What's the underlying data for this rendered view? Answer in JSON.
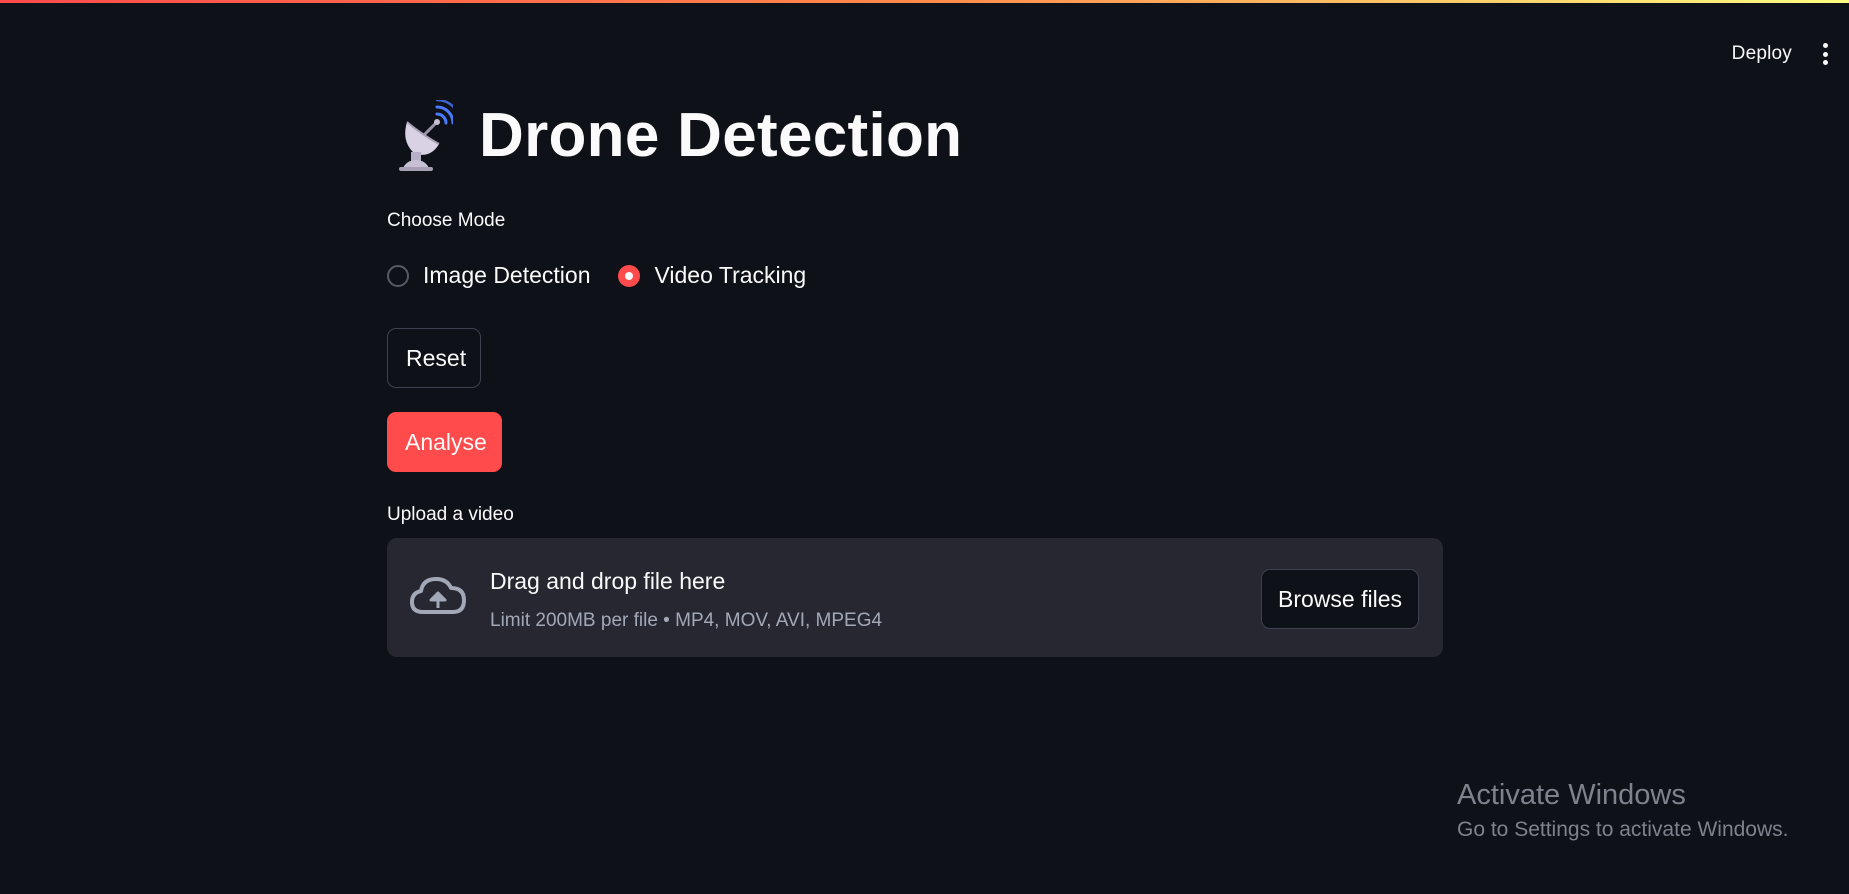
{
  "header": {
    "deploy_label": "Deploy",
    "menu_icon": "kebab-menu-icon",
    "accent_stripe": [
      "#ff4b4b",
      "#fffd80"
    ]
  },
  "main": {
    "title_icon": "satellite-antenna-icon",
    "title": "Drone Detection",
    "mode_label": "Choose Mode",
    "modes": [
      {
        "label": "Image Detection",
        "selected": false
      },
      {
        "label": "Video Tracking",
        "selected": true
      }
    ],
    "reset_label": "Reset",
    "analyse_label": "Analyse",
    "upload": {
      "label": "Upload a video",
      "drop_text": "Drag and drop file here",
      "limit_text": "Limit 200MB per file • MP4, MOV, AVI, MPEG4",
      "browse_label": "Browse files",
      "icon": "cloud-upload-icon"
    }
  },
  "watermark": {
    "title": "Activate Windows",
    "subtitle": "Go to Settings to activate Windows."
  },
  "colors": {
    "background": "#0e1117",
    "primary": "#ff4b4b",
    "surface": "#262730",
    "text": "#fafafa"
  }
}
